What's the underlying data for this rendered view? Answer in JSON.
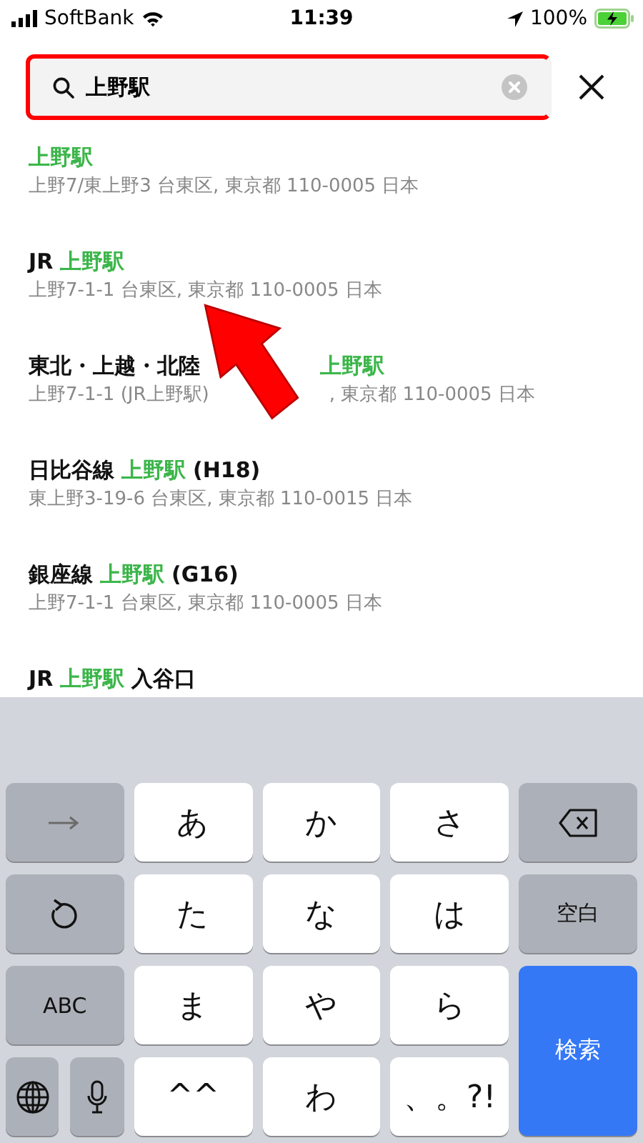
{
  "status_bar": {
    "carrier": "SoftBank",
    "time": "11:39",
    "battery": "100%"
  },
  "search": {
    "value": "上野駅",
    "highlighted": true
  },
  "results": [
    {
      "title": [
        {
          "kind": "match",
          "text": "上野駅"
        }
      ],
      "address": [
        {
          "kind": "text",
          "text": "上野7/東上野3 台東区, 東京都 110-0005 日本"
        }
      ]
    },
    {
      "title": [
        {
          "kind": "text",
          "text": "JR"
        },
        {
          "kind": "match",
          "text": "上野駅"
        }
      ],
      "address": [
        {
          "kind": "text",
          "text": "上野7-1-1 台東区, 東京都 110-0005 日本"
        }
      ]
    },
    {
      "title": [
        {
          "kind": "text",
          "text": "東北・上越・北陸"
        },
        {
          "kind": "covered"
        },
        {
          "kind": "match",
          "text": "上野駅"
        }
      ],
      "address": [
        {
          "kind": "text",
          "text": "上野7-1-1 (JR上野駅)"
        },
        {
          "kind": "covered"
        },
        {
          "kind": "text",
          "text": ", 東京都 110-0005 日本"
        }
      ]
    },
    {
      "title": [
        {
          "kind": "text",
          "text": "日比谷線"
        },
        {
          "kind": "match",
          "text": "上野駅"
        },
        {
          "kind": "text",
          "text": "(H18)"
        }
      ],
      "address": [
        {
          "kind": "text",
          "text": "東上野3-19-6 台東区, 東京都 110-0015 日本"
        }
      ]
    },
    {
      "title": [
        {
          "kind": "text",
          "text": "銀座線"
        },
        {
          "kind": "match",
          "text": "上野駅"
        },
        {
          "kind": "text",
          "text": "(G16)"
        }
      ],
      "address": [
        {
          "kind": "text",
          "text": "上野7-1-1 台東区, 東京都 110-0005 日本"
        }
      ]
    },
    {
      "title": [
        {
          "kind": "text",
          "text": "JR"
        },
        {
          "kind": "match",
          "text": "上野駅"
        },
        {
          "kind": "text",
          "text": "入谷口"
        }
      ]
    }
  ],
  "keyboard": {
    "keys": [
      {
        "kind": "next"
      },
      {
        "kind": "char",
        "label": "あ"
      },
      {
        "kind": "char",
        "label": "か"
      },
      {
        "kind": "char",
        "label": "さ"
      },
      {
        "kind": "delete"
      },
      {
        "kind": "undo"
      },
      {
        "kind": "char",
        "label": "た"
      },
      {
        "kind": "char",
        "label": "な"
      },
      {
        "kind": "char",
        "label": "は"
      },
      {
        "kind": "function",
        "label": "空白"
      },
      {
        "kind": "function",
        "label": "ABC"
      },
      {
        "kind": "char",
        "label": "ま"
      },
      {
        "kind": "char",
        "label": "や"
      },
      {
        "kind": "char",
        "label": "ら"
      },
      {
        "kind": "primary",
        "label": "検索"
      },
      {
        "kind": "globe-mic"
      },
      {
        "kind": "char",
        "label": "^^"
      },
      {
        "kind": "char",
        "label": "わ"
      },
      {
        "kind": "char",
        "label": "、。?!"
      }
    ]
  }
}
